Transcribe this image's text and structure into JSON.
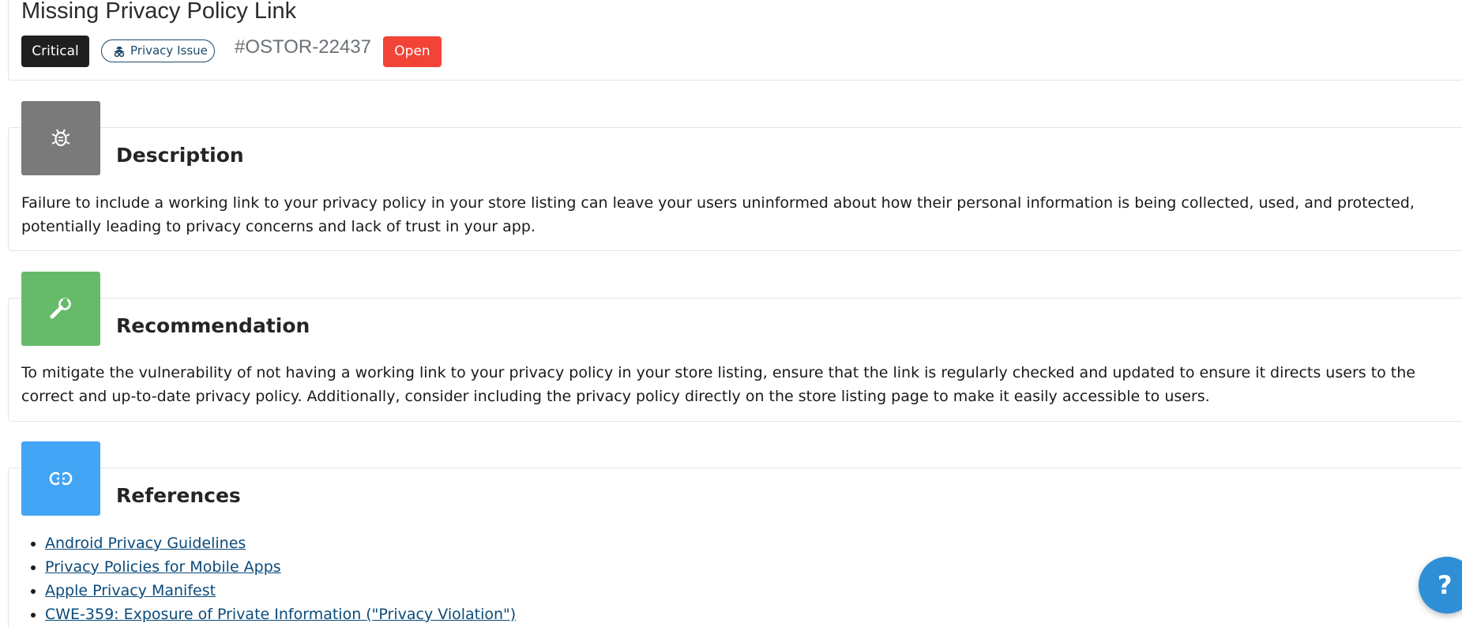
{
  "issue": {
    "title": "Missing Privacy Policy Link",
    "severity": "Critical",
    "category": "Privacy Issue",
    "id": "#OSTOR-22437",
    "status": "Open"
  },
  "sections": {
    "description": {
      "title": "Description",
      "text": "Failure to include a working link to your privacy policy in your store listing can leave your users uninformed about how their personal information is being collected, used, and protected, potentially leading to privacy concerns and lack of trust in your app."
    },
    "recommendation": {
      "title": "Recommendation",
      "text": "To mitigate the vulnerability of not having a working link to your privacy policy in your store listing, ensure that the link is regularly checked and updated to ensure it directs users to the correct and up-to-date privacy policy. Additionally, consider including the privacy policy directly on the store listing page to make it easily accessible to users."
    },
    "references": {
      "title": "References",
      "links": [
        "Android Privacy Guidelines",
        "Privacy Policies for Mobile Apps",
        "Apple Privacy Manifest",
        "CWE-359: Exposure of Private Information (\"Privacy Violation\")"
      ]
    }
  },
  "help": {
    "label": "?"
  },
  "icons": {
    "category": "spy-icon",
    "description": "bug-icon",
    "recommendation": "wrench-icon",
    "references": "link-icon",
    "help": "question-icon"
  },
  "colors": {
    "critical": "#1f1f1f",
    "open": "#f14336",
    "description_icon_bg": "#7a7a7a",
    "recommendation_icon_bg": "#66bb6a",
    "references_icon_bg": "#42a5f5",
    "help_button": "#2f8fd6",
    "link": "#0a4a7a"
  }
}
